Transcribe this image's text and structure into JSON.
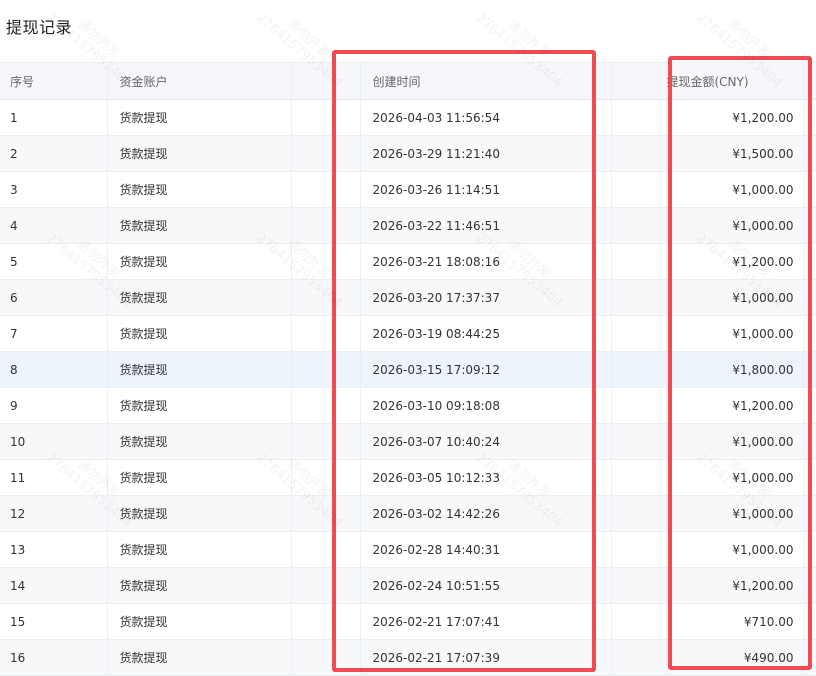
{
  "page": {
    "title": "提现记录"
  },
  "table": {
    "headers": {
      "index": "序号",
      "account": "资金账户",
      "created_at": "创建时间",
      "amount": "提现金额(CNY)"
    },
    "rows": [
      {
        "index": "1",
        "account": "货款提现",
        "created_at": "2026-04-03 11:56:54",
        "amount": "¥1,200.00"
      },
      {
        "index": "2",
        "account": "货款提现",
        "created_at": "2026-03-29 11:21:40",
        "amount": "¥1,500.00"
      },
      {
        "index": "3",
        "account": "货款提现",
        "created_at": "2026-03-26 11:14:51",
        "amount": "¥1,000.00"
      },
      {
        "index": "4",
        "account": "货款提现",
        "created_at": "2026-03-22 11:46:51",
        "amount": "¥1,000.00"
      },
      {
        "index": "5",
        "account": "货款提现",
        "created_at": "2026-03-21 18:08:16",
        "amount": "¥1,200.00"
      },
      {
        "index": "6",
        "account": "货款提现",
        "created_at": "2026-03-20 17:37:37",
        "amount": "¥1,000.00"
      },
      {
        "index": "7",
        "account": "货款提现",
        "created_at": "2026-03-19 08:44:25",
        "amount": "¥1,000.00"
      },
      {
        "index": "8",
        "account": "货款提现",
        "created_at": "2026-03-15 17:09:12",
        "amount": "¥1,800.00"
      },
      {
        "index": "9",
        "account": "货款提现",
        "created_at": "2026-03-10 09:18:08",
        "amount": "¥1,200.00"
      },
      {
        "index": "10",
        "account": "货款提现",
        "created_at": "2026-03-07 10:40:24",
        "amount": "¥1,000.00"
      },
      {
        "index": "11",
        "account": "货款提现",
        "created_at": "2026-03-05 10:12:33",
        "amount": "¥1,000.00"
      },
      {
        "index": "12",
        "account": "货款提现",
        "created_at": "2026-03-02 14:42:26",
        "amount": "¥1,000.00"
      },
      {
        "index": "13",
        "account": "货款提现",
        "created_at": "2026-02-28 14:40:31",
        "amount": "¥1,000.00"
      },
      {
        "index": "14",
        "account": "货款提现",
        "created_at": "2026-02-24 10:51:55",
        "amount": "¥1,200.00"
      },
      {
        "index": "15",
        "account": "货款提现",
        "created_at": "2026-02-21 17:07:41",
        "amount": "¥710.00"
      },
      {
        "index": "16",
        "account": "货款提现",
        "created_at": "2026-02-21 17:07:39",
        "amount": "¥490.00"
      }
    ],
    "highlighted_row": 7
  },
  "watermark": {
    "text": "请勿外发\n2764157953404"
  },
  "colors": {
    "highlight_frame": "#ef4b51",
    "header_bg": "#f5f7fa",
    "stripe_bg": "#f7f8fa",
    "hover_row_bg": "#eef4fc"
  }
}
